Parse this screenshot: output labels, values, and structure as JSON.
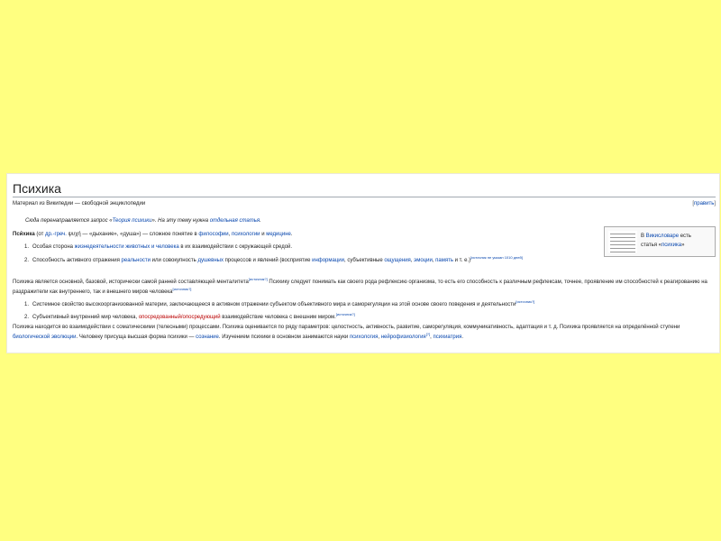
{
  "article": {
    "title": "Психика",
    "tagline": "Материал из Википедии — свободной энциклопедии",
    "edit": {
      "open": "[",
      "label": "править",
      "close": "]"
    },
    "hatnote": {
      "part1": "Сюда перенаправляется запрос «",
      "link1": "Теория психики",
      "part2": "». На эту тему нужна ",
      "link2": "отдельная статья",
      "part3": "."
    },
    "intro": {
      "bold": "Пси́хика",
      "t1": " (от ",
      "l1": "др.-греч.",
      "t2": " ψυχή — «дыхание», «душа») — сложное понятие в ",
      "l2": "философии",
      "t3": ", ",
      "l3": "психологии",
      "t4": " и ",
      "l4": "медицине",
      "t5": "."
    },
    "list1": [
      {
        "n": "1.",
        "t1": "Особая сторона ",
        "l1": "жизнедеятельности животных и человека",
        "t2": " в их взаимодействии с окружающей средой."
      },
      {
        "n": "2.",
        "t1": "Способность активного отражения ",
        "l1": "реальности",
        "t2": " или совокупность ",
        "l2": "душевных",
        "t3": " процессов и явлений (восприятие ",
        "l3": "информации",
        "t4": ", субъективные ",
        "l4": "ощущения",
        "t5": ", ",
        "l5": "эмоции",
        "t6": ", ",
        "l6": "память",
        "t7": " и т. е.)",
        "sup": "[источник не указан 1010 дней]"
      }
    ],
    "para2": {
      "t1": "Психика является основной, базовой, исторически самой ранней составляющей менталитета",
      "sup1": "[источник?]",
      "t2": " Психику следует понимать как своего рода рефлексию организма, то есть его способность к различным рефлексам, точнее, проявление им способностей к реагированию на раздражители как внутреннего, так и внешнего миров человека",
      "sup2": "[источник?]"
    },
    "list2": [
      {
        "n": "1.",
        "t1": "Системное свойство высокоорганизованной материи, заключающееся в активном отражении субъектом объективного мира и саморегуляции на этой основе своего поведения и деятельности",
        "sup": "[источник?]"
      },
      {
        "n": "2.",
        "t1": "Субъективный внутренний мир человека, ",
        "red": "опосредованный/опосредующий",
        "t2": " взаимодействие человека с внешним миром.",
        "sup": "[источник?]"
      }
    ],
    "para3": {
      "t1": "Психика находится во взаимодействии с соматическими (телесными) процессами. Психика оценивается по ряду параметров: целостность, активность, развитие, саморегуляция, коммуникативность, адаптация и т. д. Психика проявляется на определённой ступени ",
      "l1": "биологической эволюции",
      "t2": ". Человеку присуща высшая форма психики — ",
      "l2": "сознание",
      "t3": ". Изучением психики в основном занимаются науки ",
      "l3": "психология",
      "t4": ", ",
      "l4": "нейрофизиология",
      "sup": "[?]",
      "t5": ", ",
      "l5": "психиатрия",
      "t6": "."
    },
    "wiktionary": {
      "t1": "В ",
      "l1": "Викисловаре",
      "t2": " есть",
      "t3": "статья «",
      "l2": "психика",
      "t4": "»"
    }
  }
}
